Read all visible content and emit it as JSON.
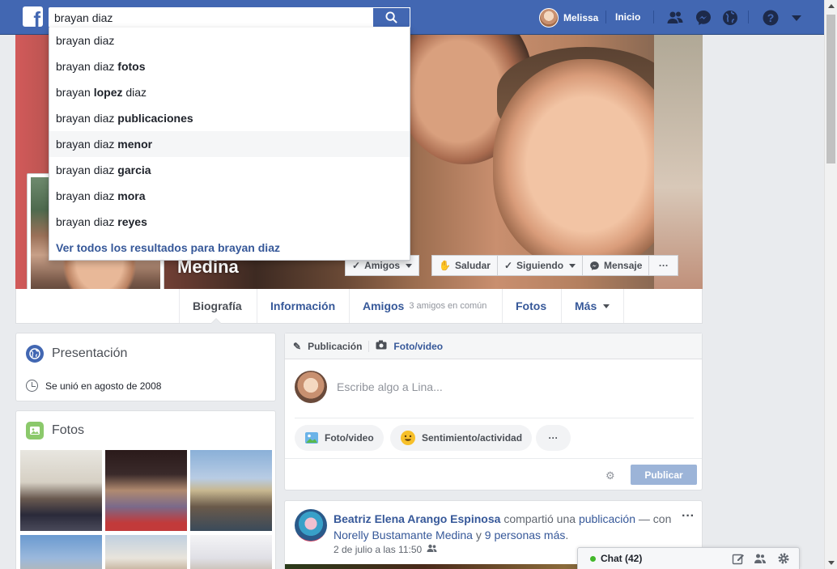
{
  "topbar": {
    "search_value": "brayan diaz",
    "user_name": "Melissa",
    "home_label": "Inicio",
    "brand_color": "#4267b2"
  },
  "search_suggestions": {
    "items": [
      {
        "prefix": "brayan diaz",
        "suffix": ""
      },
      {
        "prefix": "brayan diaz ",
        "suffix": "fotos"
      },
      {
        "prefix": "brayan ",
        "suffix": "lopez",
        "tail": " diaz"
      },
      {
        "prefix": "brayan diaz ",
        "suffix": "publicaciones"
      },
      {
        "prefix": "brayan diaz ",
        "suffix": "menor"
      },
      {
        "prefix": "brayan diaz ",
        "suffix": "garcia"
      },
      {
        "prefix": "brayan diaz ",
        "suffix": "mora"
      },
      {
        "prefix": "brayan diaz ",
        "suffix": "reyes"
      }
    ],
    "see_all": "Ver todos los resultados para brayan diaz"
  },
  "profile": {
    "name_visible": "Medina",
    "buttons": {
      "friends": "Amigos",
      "greet": "Saludar",
      "following": "Siguiendo",
      "message": "Mensaje",
      "more": "···"
    }
  },
  "tabs": [
    {
      "label": "Biografía"
    },
    {
      "label": "Información"
    },
    {
      "label": "Amigos",
      "sub": "3 amigos en común"
    },
    {
      "label": "Fotos"
    },
    {
      "label": "Más"
    }
  ],
  "intro": {
    "title": "Presentación",
    "joined": "Se unió en agosto de 2008"
  },
  "photos": {
    "title": "Fotos"
  },
  "composer": {
    "tab_post": "Publicación",
    "tab_photo": "Foto/video",
    "placeholder": "Escribe algo a Lina...",
    "photo_video": "Foto/video",
    "feeling": "Sentimiento/actividad",
    "more": "···",
    "publish": "Publicar"
  },
  "post": {
    "author": "Beatriz Elena Arango Espinosa",
    "shared_text": " compartió una ",
    "shared_link": "publicación",
    "with_text": " — con ",
    "tagged": "Norelly Bustamante Medina",
    "and_text": " y ",
    "others": "9 personas más",
    "period": ".",
    "timestamp": "2 de julio a las 11:50",
    "more": "···"
  },
  "chat": {
    "label": "Chat (42)"
  }
}
